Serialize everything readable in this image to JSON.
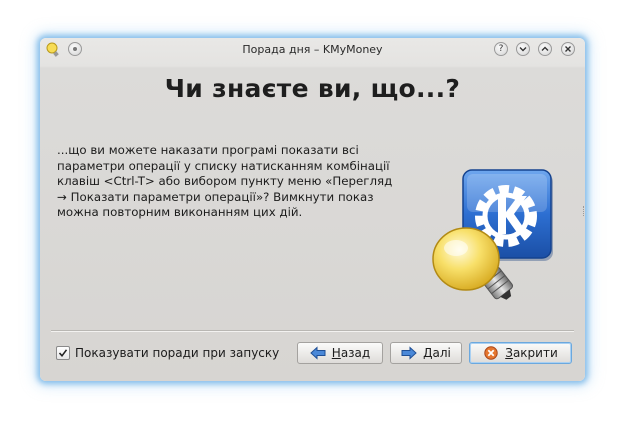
{
  "window": {
    "title": "Порада дня – KMyMoney",
    "title_buttons": [
      "help-icon",
      "minimize-icon",
      "maximize-icon",
      "close-icon"
    ]
  },
  "heading": "Чи знаєте ви, що...?",
  "tip_text": "...що ви можете наказати програмі показати всі\nпараметри операції у списку натисканням комбінації\nклавіш <Ctrl-T> або вибором пункту меню «Перегляд\n→ Показати параметри операції»? Вимкнути показ\nможна повторним виконанням цих дій.",
  "startup_checkbox": {
    "label": "Показувати поради при запуску",
    "checked": true
  },
  "buttons": {
    "back": {
      "label_accel": "Н",
      "label_rest": "азад",
      "icon": "arrow-left-icon"
    },
    "next": {
      "label_accel": "Д",
      "label_rest": "алі",
      "icon": "arrow-right-icon"
    },
    "close": {
      "label_accel": "З",
      "label_rest": "акрити",
      "icon": "close-circle-icon"
    }
  },
  "colors": {
    "accent": "#3a86d6",
    "focus_glow": "#69afe6",
    "kde_blue": "#2d6fd2",
    "bulb_yellow": "#f5d247"
  }
}
